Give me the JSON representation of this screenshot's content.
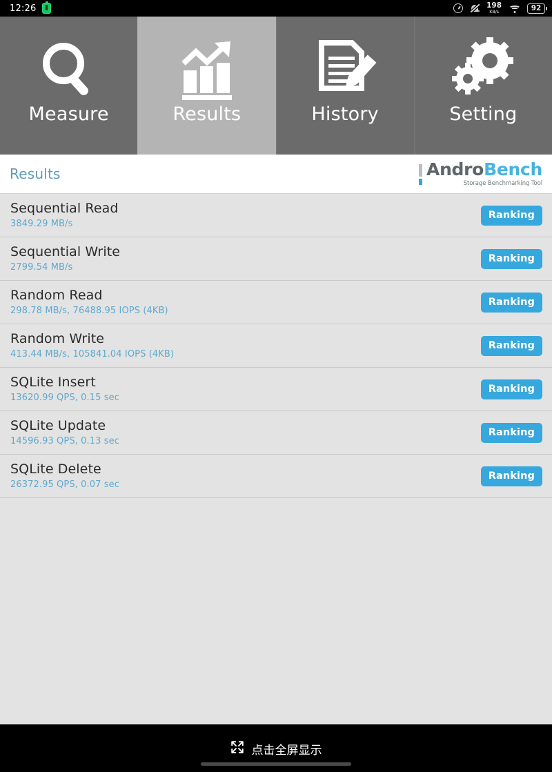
{
  "statusbar": {
    "time": "12:26",
    "battery_icon": "battery-charging-icon",
    "compass_icon": "compass-icon",
    "notification_mute_icon": "bell-mute-icon",
    "network_speed_value": "198",
    "network_speed_unit": "KB/s",
    "wifi_icon": "wifi-icon",
    "battery_percent": "92"
  },
  "tabs": [
    {
      "label": "Measure",
      "icon": "magnifier-icon",
      "active": false
    },
    {
      "label": "Results",
      "icon": "bar-chart-trend-icon",
      "active": true
    },
    {
      "label": "History",
      "icon": "document-pen-icon",
      "active": false
    },
    {
      "label": "Setting",
      "icon": "gears-icon",
      "active": false
    }
  ],
  "header": {
    "title": "Results",
    "logo_word_1": "Andro",
    "logo_word_2": "Bench",
    "logo_subtitle": "Storage Benchmarking Tool"
  },
  "results": {
    "ranking_label": "Ranking",
    "rows": [
      {
        "title": "Sequential Read",
        "value": "3849.29 MB/s"
      },
      {
        "title": "Sequential Write",
        "value": "2799.54 MB/s"
      },
      {
        "title": "Random Read",
        "value": "298.78 MB/s, 76488.95 IOPS (4KB)"
      },
      {
        "title": "Random Write",
        "value": "413.44 MB/s, 105841.04 IOPS (4KB)"
      },
      {
        "title": "SQLite Insert",
        "value": "13620.99 QPS, 0.15 sec"
      },
      {
        "title": "SQLite Update",
        "value": "14596.93 QPS, 0.13 sec"
      },
      {
        "title": "SQLite Delete",
        "value": "26372.95 QPS, 0.07 sec"
      }
    ]
  },
  "bottombar": {
    "fullscreen_icon": "fullscreen-expand-icon",
    "fullscreen_label": "点击全屏显示"
  },
  "colors": {
    "accent_blue": "#36a8dd",
    "value_blue": "#5ea9cd",
    "title_teal": "#5c9cb8",
    "tab_inactive": "#6b6b6b",
    "tab_active": "#b4b4b4",
    "list_bg": "#e3e3e3"
  }
}
